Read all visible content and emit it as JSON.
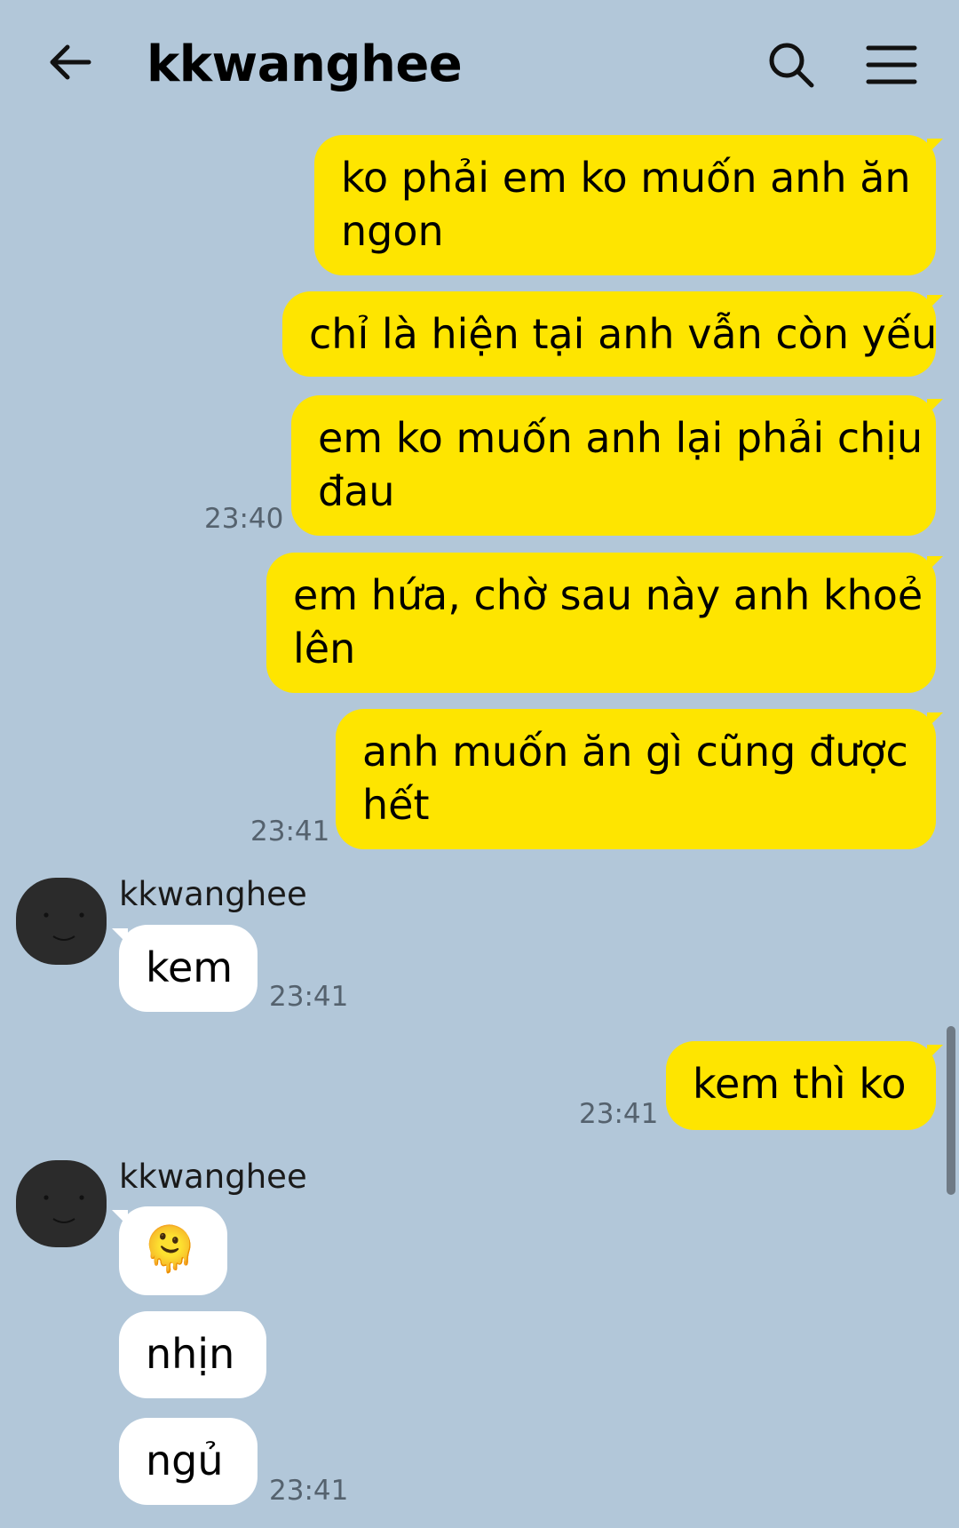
{
  "header": {
    "title": "kkwanghee",
    "back_icon": "arrow-left-icon",
    "search_icon": "search-icon",
    "menu_icon": "hamburger-menu-icon"
  },
  "colors": {
    "background": "#b2c7d9",
    "outgoing_bubble": "#fee500",
    "incoming_bubble": "#ffffff"
  },
  "messages": [
    {
      "dir": "out",
      "lines": [
        "ko phải em ko muốn anh ăn",
        "ngon"
      ]
    },
    {
      "dir": "out",
      "lines": [
        "chỉ là hiện tại anh vẫn còn yếu"
      ]
    },
    {
      "dir": "out",
      "lines": [
        "em ko muốn anh lại phải chịu",
        "đau"
      ],
      "time": "23:40"
    },
    {
      "dir": "out",
      "lines": [
        "em hứa, chờ sau này anh khoẻ",
        "lên"
      ]
    },
    {
      "dir": "out",
      "lines": [
        "anh muốn ăn gì cũng được",
        "hết"
      ],
      "time": "23:41"
    },
    {
      "dir": "in",
      "sender": "kkwanghee",
      "lines": [
        "kem"
      ],
      "time": "23:41"
    },
    {
      "dir": "out",
      "lines": [
        "kem thì ko"
      ],
      "time": "23:41"
    },
    {
      "dir": "in",
      "sender": "kkwanghee",
      "lines": [
        "🫠"
      ]
    },
    {
      "dir": "in",
      "lines": [
        "nhịn"
      ]
    },
    {
      "dir": "in",
      "lines": [
        "ngủ"
      ],
      "time": "23:41"
    }
  ]
}
